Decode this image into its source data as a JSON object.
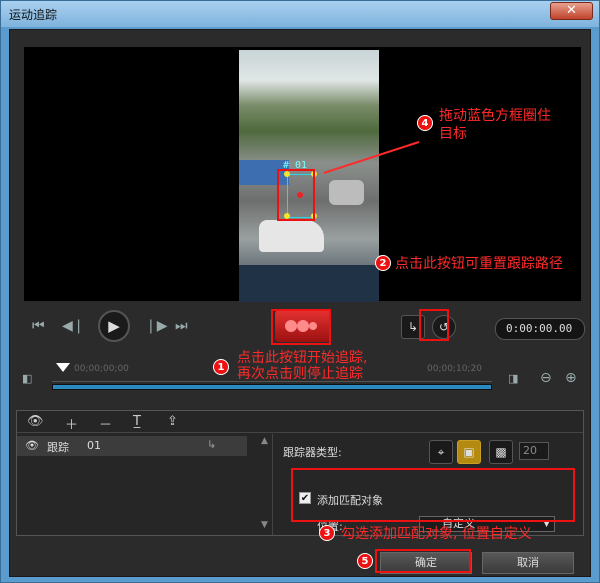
{
  "window": {
    "title": "运动追踪",
    "close_icon": "close-icon"
  },
  "video": {
    "track_label": "# 01"
  },
  "controls": {
    "timecode": "0:00:00.00"
  },
  "timeline": {
    "start_time": "00;00;00;00",
    "mark_time": "00;00;10;20"
  },
  "tracker_list": {
    "item_name": "跟踪",
    "item_id": "01"
  },
  "settings": {
    "tracker_type_label": "跟踪器类型:",
    "spin_value": "20",
    "add_match_label": "添加匹配对象",
    "position_label": "位置:",
    "position_value": "自定义"
  },
  "buttons": {
    "ok": "确定",
    "cancel": "取消"
  },
  "annotations": {
    "a1": "点击此按钮开始追踪,",
    "a1b": "再次点击则停止追踪",
    "a2": "点击此按钮可重置跟踪路径",
    "a3": "勾选添加匹配对象, 位置自定义",
    "a4": "拖动蓝色方框圈住",
    "a4b": "目标"
  },
  "colors": {
    "accent": "#2b8bc0",
    "annotation": "#ff2a2a",
    "track_box": "#29d6e6"
  }
}
